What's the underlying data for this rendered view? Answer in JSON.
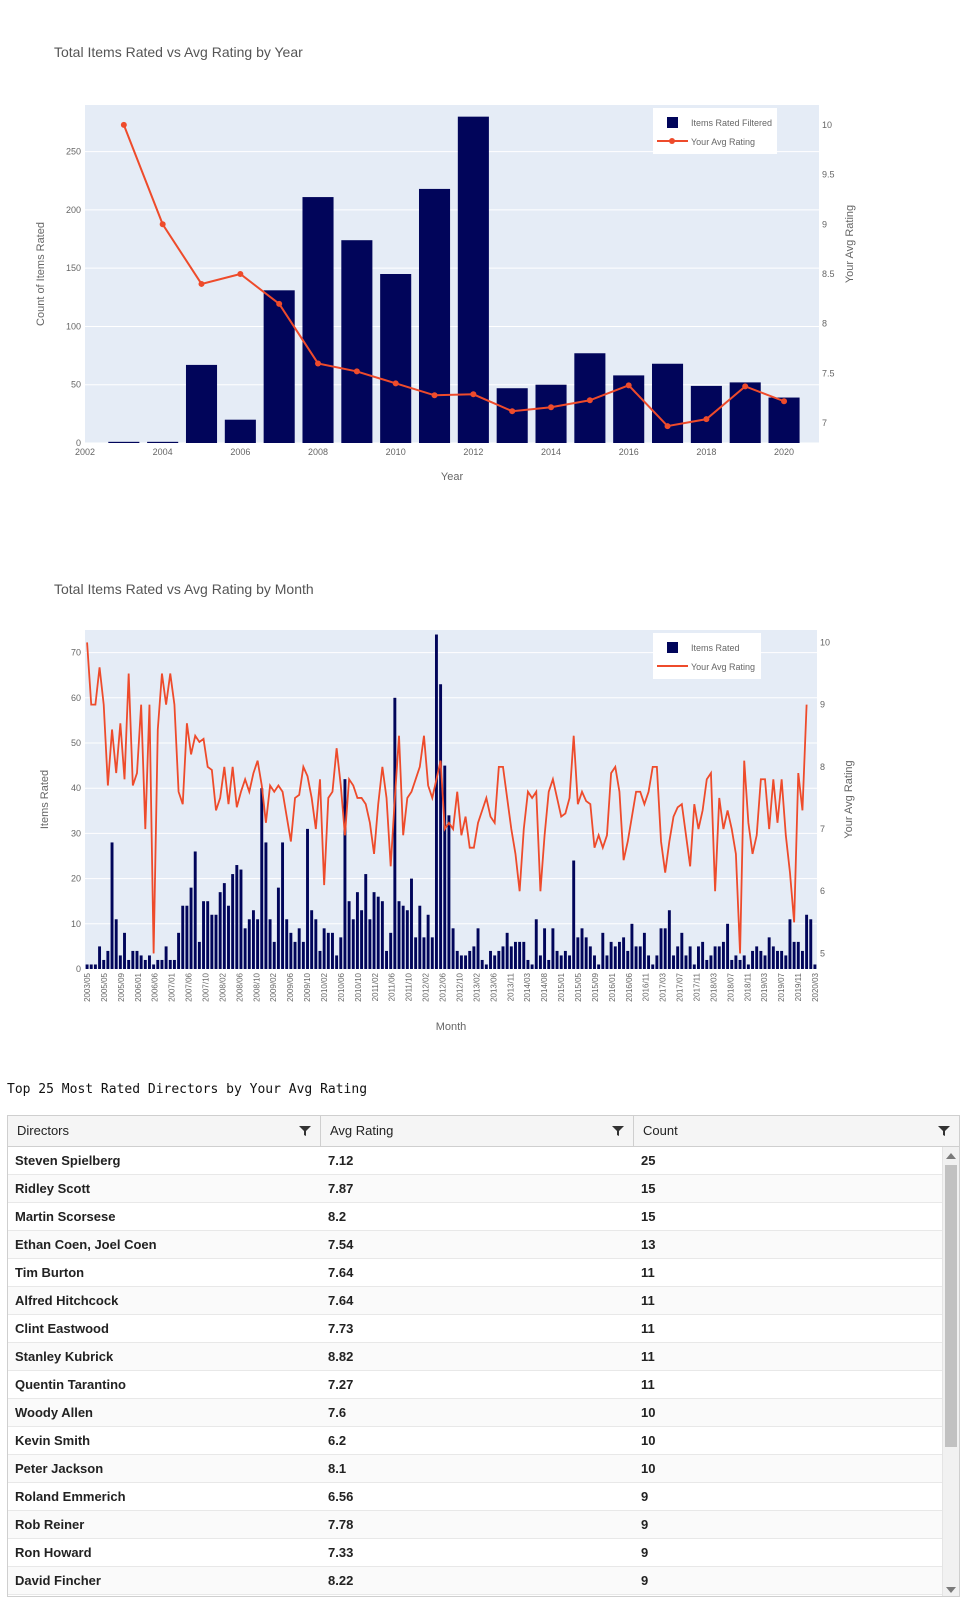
{
  "chart_data": [
    {
      "type": "bar",
      "title": "Total Items Rated vs Avg Rating by Year",
      "xlabel": "Year",
      "ylabel": "Count of Items Rated",
      "y2label": "Your Avg Rating",
      "xlim": [
        2002,
        2020.9
      ],
      "ylim": [
        0,
        290
      ],
      "y2lim": [
        6.8,
        10.2
      ],
      "x_ticks": [
        2002,
        2004,
        2006,
        2008,
        2010,
        2012,
        2014,
        2016,
        2018,
        2020
      ],
      "y_ticks": [
        0,
        50,
        100,
        150,
        200,
        250
      ],
      "y2_ticks": [
        7,
        7.5,
        8,
        8.5,
        9,
        9.5,
        10
      ],
      "legend_position": "top-right",
      "colors": {
        "bars": "#01055a",
        "line": "#ee4b2b",
        "plot_bg": "#e5ecf6"
      },
      "x": [
        2003,
        2004,
        2005,
        2006,
        2007,
        2008,
        2009,
        2010,
        2011,
        2012,
        2013,
        2014,
        2015,
        2016,
        2017,
        2018,
        2019,
        2020
      ],
      "series": [
        {
          "name": "Items Rated Filtered",
          "kind": "bar",
          "axis": "y",
          "values": [
            1,
            1,
            67,
            20,
            131,
            211,
            174,
            145,
            218,
            280,
            47,
            50,
            77,
            58,
            68,
            49,
            52,
            39
          ]
        },
        {
          "name": "Your Avg Rating",
          "kind": "line+markers",
          "axis": "y2",
          "values": [
            10,
            9,
            8.4,
            8.5,
            8.2,
            7.6,
            7.52,
            7.4,
            7.28,
            7.29,
            7.12,
            7.16,
            7.23,
            7.38,
            6.97,
            7.04,
            7.37,
            7.22
          ]
        }
      ]
    },
    {
      "type": "bar",
      "title": "Total Items Rated vs Avg Rating by Month",
      "xlabel": "Month",
      "ylabel": "Items Rated",
      "y2label": "Your Avg Rating",
      "ylim": [
        0,
        75
      ],
      "y2lim": [
        4.75,
        10.2
      ],
      "y_ticks": [
        0,
        10,
        20,
        30,
        40,
        50,
        60,
        70
      ],
      "y2_ticks": [
        5,
        6,
        7,
        8,
        9,
        10
      ],
      "x_ticks": [
        "2003/05",
        "2005/05",
        "2005/09",
        "2006/01",
        "2006/06",
        "2007/01",
        "2007/06",
        "2007/10",
        "2008/02",
        "2008/06",
        "2008/10",
        "2009/02",
        "2009/06",
        "2009/10",
        "2010/02",
        "2010/06",
        "2010/10",
        "2011/02",
        "2011/06",
        "2011/10",
        "2012/02",
        "2012/06",
        "2012/10",
        "2013/02",
        "2013/06",
        "2013/11",
        "2014/03",
        "2014/08",
        "2015/01",
        "2015/05",
        "2015/09",
        "2016/01",
        "2016/06",
        "2016/11",
        "2017/03",
        "2017/07",
        "2017/11",
        "2018/03",
        "2018/07",
        "2018/11",
        "2019/03",
        "2019/07",
        "2019/11",
        "2020/03"
      ],
      "legend_position": "top-right",
      "colors": {
        "bars": "#01055a",
        "line": "#ee4b2b",
        "plot_bg": "#e5ecf6"
      },
      "series": [
        {
          "name": "Items Rated",
          "kind": "bar",
          "axis": "y",
          "values": [
            1,
            1,
            1,
            5,
            2,
            4,
            28,
            11,
            3,
            8,
            2,
            4,
            4,
            3,
            2,
            3,
            1,
            2,
            2,
            5,
            2,
            2,
            8,
            14,
            14,
            18,
            26,
            6,
            15,
            15,
            12,
            12,
            17,
            19,
            14,
            21,
            23,
            22,
            9,
            11,
            13,
            11,
            40,
            28,
            11,
            6,
            18,
            28,
            11,
            8,
            6,
            9,
            6,
            31,
            13,
            11,
            4,
            9,
            8,
            8,
            3,
            7,
            42,
            15,
            11,
            17,
            13,
            21,
            11,
            17,
            16,
            15,
            4,
            8,
            60,
            15,
            14,
            13,
            20,
            7,
            14,
            7,
            12,
            7,
            74,
            63,
            45,
            34,
            9,
            4,
            3,
            3,
            4,
            5,
            9,
            2,
            1,
            4,
            3,
            4,
            5,
            8,
            5,
            6,
            6,
            6,
            2,
            1,
            11,
            3,
            9,
            2,
            9,
            4,
            3,
            4,
            3,
            24,
            7,
            9,
            7,
            5,
            3,
            1,
            8,
            3,
            6,
            5,
            6,
            7,
            4,
            10,
            5,
            5,
            8,
            3,
            1,
            3,
            9,
            9,
            13,
            3,
            5,
            8,
            3,
            5,
            1,
            5,
            6,
            2,
            3,
            5,
            5,
            6,
            10,
            2,
            3,
            2,
            3,
            1,
            4,
            5,
            4,
            3,
            7,
            5,
            4,
            4,
            3,
            11,
            6,
            6,
            4,
            12,
            11,
            1
          ]
        },
        {
          "name": "Your Avg Rating",
          "kind": "line",
          "axis": "y2",
          "values": [
            10,
            9,
            9,
            9.6,
            9,
            7.7,
            8.6,
            7.9,
            8.7,
            7.8,
            9.5,
            7.7,
            7.9,
            9,
            7,
            9,
            5,
            8.6,
            9.5,
            9,
            9.5,
            9,
            7.6,
            7.4,
            8.7,
            8.2,
            8.5,
            8.4,
            8.45,
            8,
            7.95,
            7.3,
            7.5,
            8,
            7.4,
            8,
            7.35,
            7.6,
            7.8,
            7.6,
            7.9,
            8.1,
            7.7,
            7.1,
            7.7,
            7.6,
            7.7,
            7.6,
            7.2,
            6.8,
            7.5,
            7.55,
            8,
            7.85,
            7.5,
            7,
            7.8,
            6.1,
            7.5,
            7.6,
            8.3,
            7.7,
            6.9,
            7.8,
            7.7,
            7.5,
            7.5,
            7.4,
            7.1,
            6.6,
            7.4,
            8,
            7.5,
            6.4,
            7.5,
            8.5,
            6.9,
            7.5,
            7.6,
            7.8,
            8,
            8.5,
            7.7,
            7.5,
            7.8,
            8.1,
            7,
            7.1,
            7,
            7.6,
            6.9,
            7.2,
            6.7,
            6.7,
            7.1,
            7.3,
            7.5,
            7.2,
            7.1,
            8,
            8,
            7.5,
            7,
            6.6,
            6,
            7,
            7.6,
            7.5,
            7.6,
            6,
            6.9,
            7.6,
            7.8,
            7.5,
            7.2,
            7.25,
            7.5,
            8.5,
            7.4,
            7.6,
            7.45,
            7.4,
            6.7,
            6.9,
            6.7,
            6.9,
            7.9,
            8,
            7.6,
            6.5,
            6.8,
            7.2,
            7.6,
            7.6,
            7.4,
            7.6,
            8,
            8,
            6.8,
            6.3,
            6.8,
            7.2,
            7.35,
            7.4,
            6.9,
            6.4,
            7.4,
            7.0,
            7.3,
            7.8,
            7.9,
            6.0,
            7.5,
            7.0,
            7.3,
            7.0,
            6.6,
            5.0,
            8.1,
            7.1,
            6.6,
            6.9,
            7.8,
            7.8,
            7.0,
            7.8,
            7.1,
            7.8,
            6.9,
            6.3,
            5.5,
            7.9,
            7.3,
            9.0
          ]
        }
      ]
    }
  ],
  "table": {
    "title": "Top 25 Most Rated Directors by Your Avg Rating",
    "columns": [
      "Directors",
      "Avg Rating",
      "Count"
    ],
    "rows": [
      [
        "Steven Spielberg",
        "7.12",
        "25"
      ],
      [
        "Ridley Scott",
        "7.87",
        "15"
      ],
      [
        "Martin Scorsese",
        "8.2",
        "15"
      ],
      [
        "Ethan Coen, Joel Coen",
        "7.54",
        "13"
      ],
      [
        "Tim Burton",
        "7.64",
        "11"
      ],
      [
        "Alfred Hitchcock",
        "7.64",
        "11"
      ],
      [
        "Clint Eastwood",
        "7.73",
        "11"
      ],
      [
        "Stanley Kubrick",
        "8.82",
        "11"
      ],
      [
        "Quentin Tarantino",
        "7.27",
        "11"
      ],
      [
        "Woody Allen",
        "7.6",
        "10"
      ],
      [
        "Kevin Smith",
        "6.2",
        "10"
      ],
      [
        "Peter Jackson",
        "8.1",
        "10"
      ],
      [
        "Roland Emmerich",
        "6.56",
        "9"
      ],
      [
        "Rob Reiner",
        "7.78",
        "9"
      ],
      [
        "Ron Howard",
        "7.33",
        "9"
      ],
      [
        "David Fincher",
        "8.22",
        "9"
      ]
    ],
    "icons": {
      "filter": "filter-icon",
      "scroll_up": "arrow-up-icon",
      "scroll_down": "arrow-down-icon"
    }
  }
}
